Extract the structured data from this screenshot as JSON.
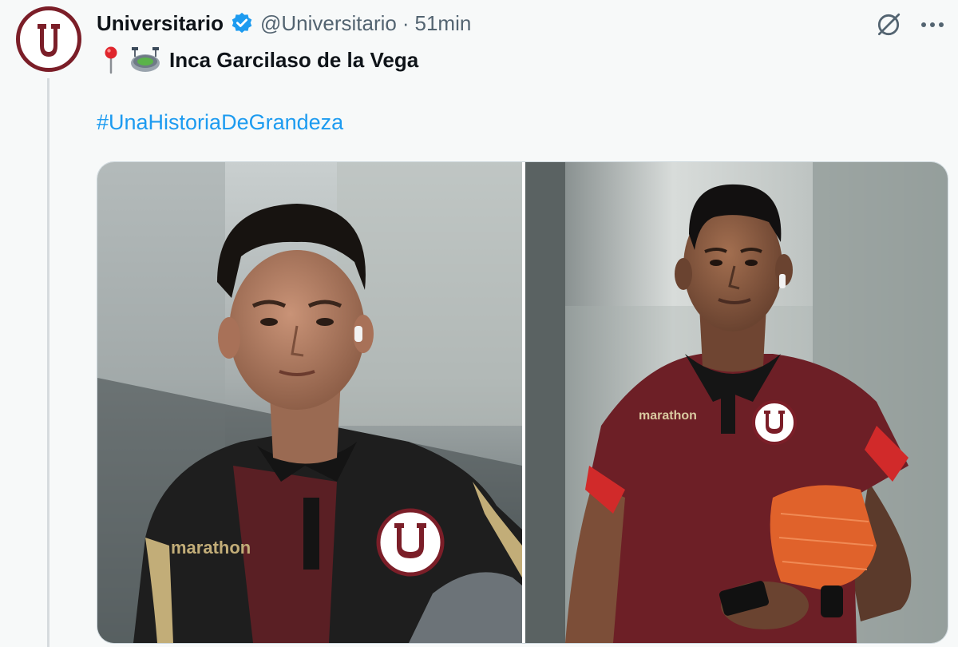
{
  "tweet": {
    "display_name": "Universitario",
    "handle": "@Universitario",
    "separator": "·",
    "time": "51min",
    "location_pin": "📍",
    "location_stadium": "🏟️",
    "location_text": "Inca Garcilaso de la Vega",
    "hashtag": "#UnaHistoriaDeGrandeza"
  },
  "media": {
    "photo_left": {
      "jersey_text": "marathon"
    },
    "photo_right": {
      "jersey_text": "marathon"
    }
  },
  "icons": {
    "avatar": "universitario-logo-icon",
    "verified": "verified-badge-icon",
    "grok": "grok-icon",
    "more": "more-icon",
    "pin": "pin-icon",
    "stadium": "stadium-icon"
  },
  "colors": {
    "brand_maroon": "#7b1e28",
    "link_blue": "#1d9bf0",
    "verified_blue": "#1d9bf0",
    "text_primary": "#0f1419",
    "text_secondary": "#536471",
    "background": "#f7f9f9"
  }
}
